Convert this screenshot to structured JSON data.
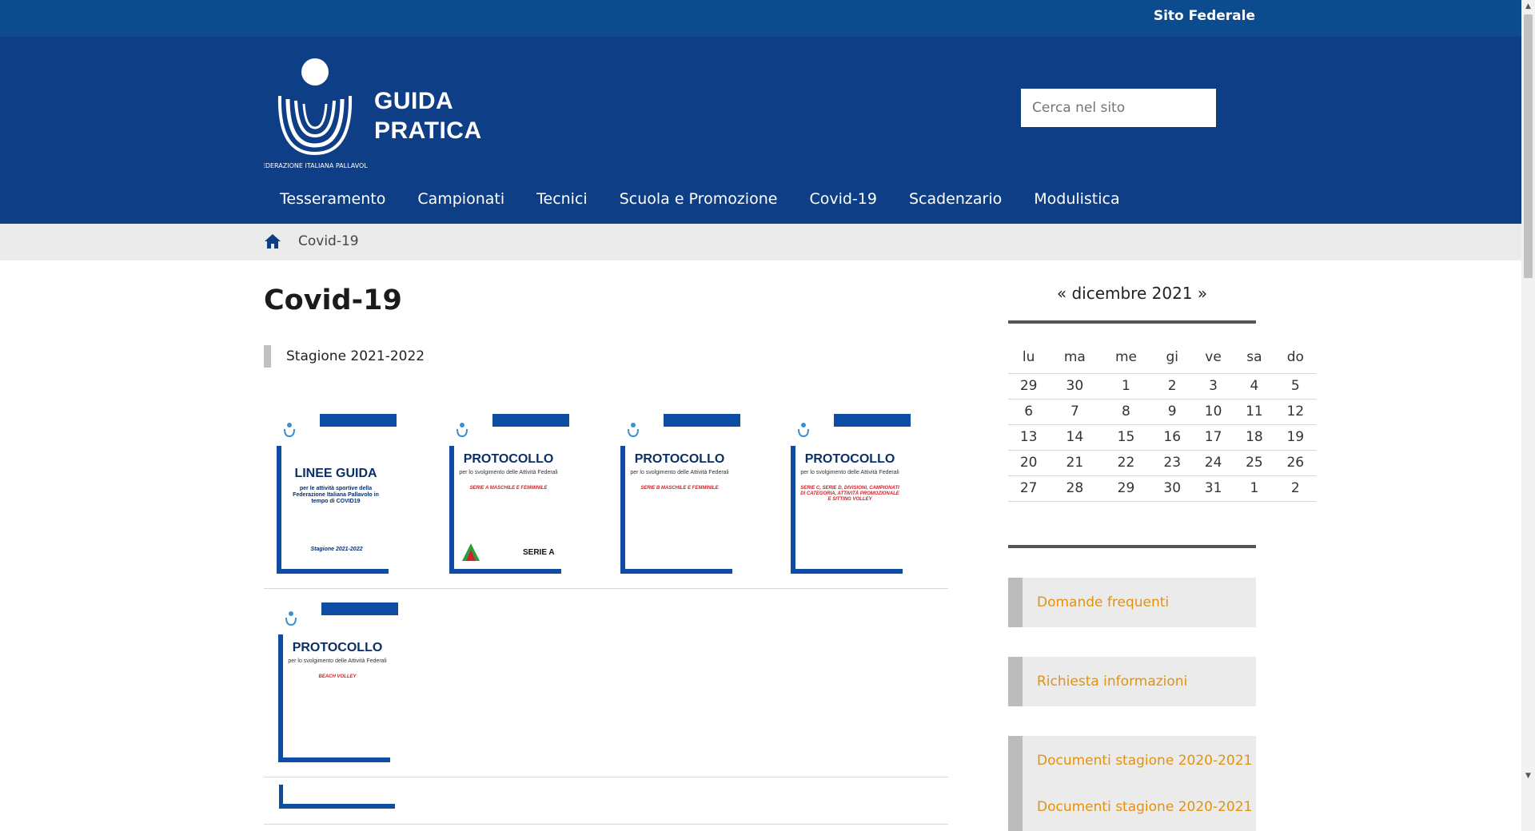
{
  "topbar": {
    "link": "Sito Federale"
  },
  "header": {
    "logo_title_line1": "GUIDA",
    "logo_title_line2": "PRATICA",
    "logo_ring_text": "FEDERAZIONE ITALIANA PALLAVOLO",
    "search_placeholder": "Cerca nel sito"
  },
  "nav": [
    "Tesseramento",
    "Campionati",
    "Tecnici",
    "Scuola e Promozione",
    "Covid-19",
    "Scadenzario",
    "Modulistica"
  ],
  "breadcrumb": {
    "home_icon": "home-icon",
    "current": "Covid-19"
  },
  "main": {
    "title": "Covid-19",
    "season": "Stagione 2021-2022",
    "docs": [
      {
        "title": "LINEE GUIDA",
        "sub": "per le attività sportive della Federazione Italiana Pallavolo in tempo di COVID19",
        "year": "Stagione 2021-2022"
      },
      {
        "title": "PROTOCOLLO",
        "sub": "per lo svolgimento delle Attività Federali",
        "red": "SERIE A MASCHILE E FEMMINILE",
        "brand": "SERIE A"
      },
      {
        "title": "PROTOCOLLO",
        "sub": "per lo svolgimento delle Attività Federali",
        "red": "SERIE B MASCHILE E FEMMINILE"
      },
      {
        "title": "PROTOCOLLO",
        "sub": "per lo svolgimento delle Attività Federali",
        "red": "SERIE C, SERIE D, DIVISIONI, CAMPIONATI DI CATEGORIA, ATTIVITÀ PROMOZIONALE E SITTING VOLLEY"
      },
      {
        "title": "PROTOCOLLO",
        "sub": "per lo svolgimento delle Attività Federali",
        "red": "BEACH VOLLEY"
      }
    ]
  },
  "calendar": {
    "prev": "«",
    "month": "dicembre 2021",
    "next": "»",
    "days": [
      "lu",
      "ma",
      "me",
      "gi",
      "ve",
      "sa",
      "do"
    ],
    "weeks": [
      [
        "29",
        "30",
        "1",
        "2",
        "3",
        "4",
        "5"
      ],
      [
        "6",
        "7",
        "8",
        "9",
        "10",
        "11",
        "12"
      ],
      [
        "13",
        "14",
        "15",
        "16",
        "17",
        "18",
        "19"
      ],
      [
        "20",
        "21",
        "22",
        "23",
        "24",
        "25",
        "26"
      ],
      [
        "27",
        "28",
        "29",
        "30",
        "31",
        "1",
        "2"
      ]
    ]
  },
  "sidebar_links": [
    "Domande frequenti",
    "Richiesta informazioni",
    "Documenti stagione 2020-2021",
    "Documenti stagione 2020-2021"
  ],
  "colors": {
    "header": "#0e3f86",
    "topbar": "#0d4b8f",
    "link_orange": "#e3920f",
    "doc_blue": "#0d4da3"
  }
}
